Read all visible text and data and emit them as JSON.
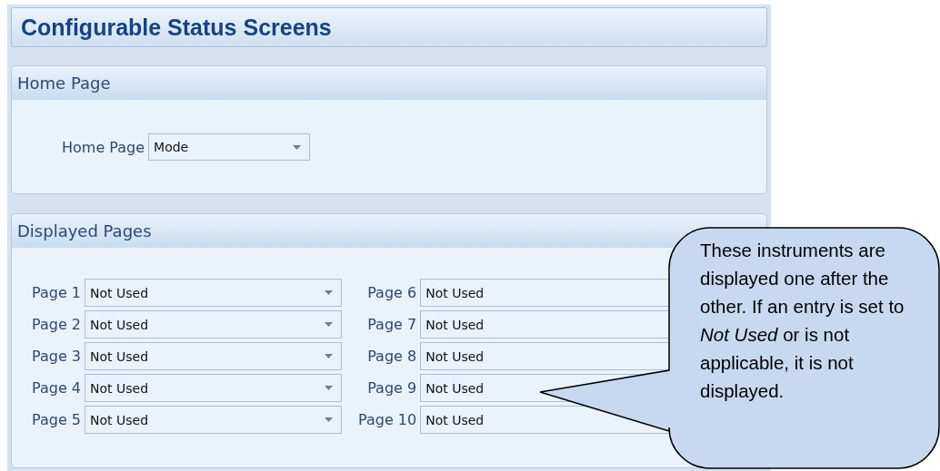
{
  "title": "Configurable Status Screens",
  "home_page": {
    "heading": "Home Page",
    "label": "Home Page",
    "value": "Mode"
  },
  "displayed_pages": {
    "heading": "Displayed Pages",
    "columns": [
      [
        {
          "label": "Page 1",
          "value": "Not Used"
        },
        {
          "label": "Page 2",
          "value": "Not Used"
        },
        {
          "label": "Page 3",
          "value": "Not Used"
        },
        {
          "label": "Page 4",
          "value": "Not Used"
        },
        {
          "label": "Page 5",
          "value": "Not Used"
        }
      ],
      [
        {
          "label": "Page 6",
          "value": "Not Used"
        },
        {
          "label": "Page 7",
          "value": "Not Used"
        },
        {
          "label": "Page 8",
          "value": "Not Used"
        },
        {
          "label": "Page 9",
          "value": "Not Used"
        },
        {
          "label": "Page 10",
          "value": "Not Used"
        }
      ]
    ]
  },
  "callout": {
    "text": "These instruments are displayed one after the other. If an entry is set to *Not Used* or is not applicable, it is not displayed."
  }
}
